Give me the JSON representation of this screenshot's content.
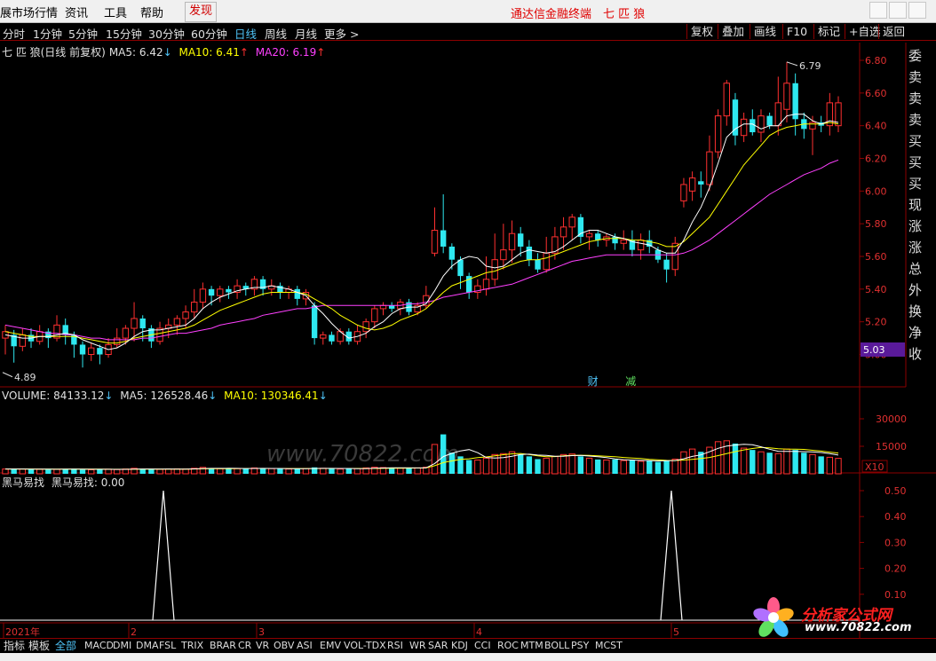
{
  "menubar": {
    "items": [
      "展市场行情",
      "资讯",
      "工具",
      "帮助"
    ],
    "discover": "发现",
    "title": "通达信金融终端　七 匹 狼"
  },
  "toolbar": {
    "periods": [
      "分时",
      "1分钟",
      "5分钟",
      "15分钟",
      "30分钟",
      "60分钟",
      "日线",
      "周线",
      "月线",
      "更多 >"
    ],
    "active_period": "日线",
    "right_buttons": [
      "复权",
      "叠加",
      "画线",
      "F10",
      "标记",
      "+自选",
      "返回"
    ]
  },
  "main_legend": {
    "stock": "七 匹 狼(日线 前复权)",
    "ma5": "MA5: 6.42",
    "ma10": "MA10: 6.41",
    "ma20": "MA20: 6.19"
  },
  "volume_legend": {
    "volume": "VOLUME: 84133.12",
    "ma5": "MA5: 126528.46",
    "ma10": "MA10: 130346.41"
  },
  "indicator_legend": {
    "name": "黑马易找",
    "value": "黑马易找: 0.00"
  },
  "side_panel": [
    "委",
    "卖",
    "卖",
    "卖",
    "买",
    "买",
    "买",
    "现",
    "涨",
    "涨",
    "总",
    "外",
    "换",
    "净",
    "收"
  ],
  "price_axis": [
    "6.80",
    "6.60",
    "6.40",
    "6.20",
    "6.00",
    "5.80",
    "5.60",
    "5.40",
    "5.20",
    "5.00"
  ],
  "current_price": "5.03",
  "volume_axis": [
    "30000",
    "15000"
  ],
  "volume_multiplier": "X10",
  "indicator_axis": [
    "0.50",
    "0.40",
    "0.30",
    "0.20",
    "0.10"
  ],
  "annotations": {
    "high": "6.79",
    "low": "4.89",
    "event_cai": "财",
    "event_jian": "减"
  },
  "date_axis": [
    "2021年",
    "2",
    "3",
    "4",
    "5"
  ],
  "bottom_tabs": [
    "指标",
    "模板",
    "全部",
    "MACD",
    "DMI",
    "DMA",
    "FSL",
    "TRIX",
    "BRAR",
    "CR",
    "VR",
    "OBV",
    "ASI",
    "EMV",
    "VOL-TDX",
    "RSI",
    "WR",
    "SAR",
    "KDJ",
    "CCI",
    "ROC",
    "MTM",
    "BOLL",
    "PSY",
    "MCST"
  ],
  "active_tab": "全部",
  "watermark": {
    "logo_text": "分析家公式网",
    "url": "www.70822.com",
    "mid_text": "www.70822.com"
  },
  "colors": {
    "up": "#ff3030",
    "down": "#2ee8f0",
    "ma5": "#ffffff",
    "ma10": "#ffff00",
    "ma20": "#ff40ff",
    "grid": "#8b0000",
    "axis_text": "#e03030"
  },
  "chart_data": [
    {
      "type": "candlestick",
      "title": "七 匹 狼(日线 前复权)",
      "ylim": [
        4.85,
        6.9
      ],
      "high_label": 6.79,
      "low_label": 4.89,
      "candles": [
        [
          5.1,
          5.14,
          5.0,
          5.18
        ],
        [
          5.12,
          5.05,
          4.95,
          5.15
        ],
        [
          5.05,
          5.12,
          5.02,
          5.16
        ],
        [
          5.12,
          5.08,
          5.04,
          5.16
        ],
        [
          5.08,
          5.14,
          5.06,
          5.18
        ],
        [
          5.14,
          5.1,
          5.04,
          5.16
        ],
        [
          5.1,
          5.18,
          5.08,
          5.24
        ],
        [
          5.18,
          5.12,
          5.06,
          5.22
        ],
        [
          5.12,
          5.06,
          4.98,
          5.14
        ],
        [
          5.06,
          5.0,
          4.92,
          5.08
        ],
        [
          5.0,
          5.04,
          4.96,
          5.07
        ],
        [
          5.04,
          5.0,
          4.94,
          5.06
        ],
        [
          5.0,
          5.06,
          4.98,
          5.1
        ],
        [
          5.06,
          5.1,
          5.04,
          5.16
        ],
        [
          5.1,
          5.16,
          5.06,
          5.18
        ],
        [
          5.16,
          5.22,
          5.08,
          5.32
        ],
        [
          5.22,
          5.16,
          5.08,
          5.24
        ],
        [
          5.16,
          5.08,
          5.04,
          5.18
        ],
        [
          5.08,
          5.16,
          5.06,
          5.2
        ],
        [
          5.16,
          5.18,
          5.1,
          5.22
        ],
        [
          5.18,
          5.22,
          5.12,
          5.24
        ],
        [
          5.22,
          5.26,
          5.16,
          5.3
        ],
        [
          5.26,
          5.32,
          5.22,
          5.4
        ],
        [
          5.32,
          5.4,
          5.28,
          5.44
        ],
        [
          5.4,
          5.36,
          5.3,
          5.42
        ],
        [
          5.36,
          5.4,
          5.32,
          5.42
        ],
        [
          5.4,
          5.38,
          5.34,
          5.42
        ],
        [
          5.38,
          5.42,
          5.34,
          5.46
        ],
        [
          5.42,
          5.4,
          5.36,
          5.44
        ],
        [
          5.4,
          5.46,
          5.36,
          5.48
        ],
        [
          5.46,
          5.4,
          5.36,
          5.48
        ],
        [
          5.4,
          5.42,
          5.36,
          5.46
        ],
        [
          5.42,
          5.38,
          5.34,
          5.44
        ],
        [
          5.38,
          5.4,
          5.34,
          5.42
        ],
        [
          5.4,
          5.34,
          5.3,
          5.42
        ],
        [
          5.34,
          5.38,
          5.3,
          5.4
        ],
        [
          5.3,
          5.1,
          5.06,
          5.32
        ],
        [
          5.1,
          5.12,
          5.06,
          5.14
        ],
        [
          5.12,
          5.08,
          5.06,
          5.14
        ],
        [
          5.08,
          5.14,
          5.06,
          5.16
        ],
        [
          5.14,
          5.08,
          5.06,
          5.16
        ],
        [
          5.08,
          5.14,
          5.06,
          5.18
        ],
        [
          5.14,
          5.2,
          5.1,
          5.22
        ],
        [
          5.2,
          5.28,
          5.16,
          5.3
        ],
        [
          5.28,
          5.3,
          5.24,
          5.32
        ],
        [
          5.3,
          5.28,
          5.26,
          5.32
        ],
        [
          5.28,
          5.32,
          5.24,
          5.34
        ],
        [
          5.32,
          5.26,
          5.24,
          5.34
        ],
        [
          5.26,
          5.3,
          5.24,
          5.32
        ],
        [
          5.3,
          5.36,
          5.28,
          5.42
        ],
        [
          5.62,
          5.76,
          5.6,
          5.9
        ],
        [
          5.76,
          5.66,
          5.62,
          5.98
        ],
        [
          5.66,
          5.58,
          5.52,
          5.68
        ],
        [
          5.58,
          5.48,
          5.4,
          5.6
        ],
        [
          5.48,
          5.38,
          5.34,
          5.5
        ],
        [
          5.38,
          5.42,
          5.34,
          5.46
        ],
        [
          5.4,
          5.46,
          5.36,
          5.6
        ],
        [
          5.46,
          5.58,
          5.42,
          5.74
        ],
        [
          5.58,
          5.64,
          5.52,
          5.8
        ],
        [
          5.64,
          5.74,
          5.56,
          5.82
        ],
        [
          5.74,
          5.66,
          5.6,
          5.78
        ],
        [
          5.66,
          5.58,
          5.54,
          5.7
        ],
        [
          5.58,
          5.52,
          5.5,
          5.62
        ],
        [
          5.52,
          5.62,
          5.5,
          5.72
        ],
        [
          5.62,
          5.72,
          5.58,
          5.78
        ],
        [
          5.72,
          5.78,
          5.64,
          5.84
        ],
        [
          5.78,
          5.84,
          5.7,
          5.86
        ],
        [
          5.84,
          5.72,
          5.68,
          5.86
        ],
        [
          5.72,
          5.74,
          5.64,
          5.76
        ],
        [
          5.74,
          5.7,
          5.66,
          5.76
        ],
        [
          5.7,
          5.72,
          5.66,
          5.74
        ],
        [
          5.72,
          5.68,
          5.64,
          5.74
        ],
        [
          5.68,
          5.7,
          5.64,
          5.76
        ],
        [
          5.7,
          5.64,
          5.6,
          5.76
        ],
        [
          5.64,
          5.7,
          5.58,
          5.74
        ],
        [
          5.7,
          5.66,
          5.62,
          5.76
        ],
        [
          5.64,
          5.58,
          5.56,
          5.66
        ],
        [
          5.58,
          5.52,
          5.44,
          5.62
        ],
        [
          5.52,
          5.68,
          5.48,
          5.72
        ],
        [
          5.94,
          6.04,
          5.9,
          6.08
        ],
        [
          6.0,
          6.08,
          5.94,
          6.12
        ],
        [
          6.06,
          6.04,
          5.96,
          6.12
        ],
        [
          6.04,
          6.24,
          6.0,
          6.34
        ],
        [
          6.24,
          6.46,
          6.2,
          6.5
        ],
        [
          6.46,
          6.66,
          6.4,
          6.68
        ],
        [
          6.56,
          6.34,
          6.28,
          6.6
        ],
        [
          6.34,
          6.44,
          6.3,
          6.48
        ],
        [
          6.44,
          6.36,
          6.34,
          6.5
        ],
        [
          6.36,
          6.46,
          6.3,
          6.5
        ],
        [
          6.46,
          6.4,
          6.38,
          6.48
        ],
        [
          6.4,
          6.54,
          6.34,
          6.7
        ],
        [
          6.5,
          6.66,
          6.42,
          6.79
        ],
        [
          6.66,
          6.44,
          6.34,
          6.72
        ],
        [
          6.44,
          6.38,
          6.32,
          6.48
        ],
        [
          6.38,
          6.42,
          6.22,
          6.46
        ],
        [
          6.42,
          6.4,
          6.36,
          6.46
        ],
        [
          6.4,
          6.54,
          6.34,
          6.6
        ],
        [
          6.4,
          6.54,
          6.36,
          6.58
        ]
      ],
      "ma5": [
        5.12,
        5.11,
        5.1,
        5.1,
        5.11,
        5.11,
        5.12,
        5.13,
        5.12,
        5.09,
        5.07,
        5.05,
        5.03,
        5.04,
        5.07,
        5.11,
        5.14,
        5.15,
        5.15,
        5.16,
        5.17,
        5.18,
        5.22,
        5.28,
        5.32,
        5.35,
        5.37,
        5.39,
        5.4,
        5.41,
        5.41,
        5.42,
        5.41,
        5.4,
        5.38,
        5.36,
        5.3,
        5.25,
        5.19,
        5.14,
        5.1,
        5.11,
        5.13,
        5.17,
        5.2,
        5.25,
        5.28,
        5.29,
        5.29,
        5.31,
        5.39,
        5.48,
        5.54,
        5.58,
        5.6,
        5.59,
        5.54,
        5.53,
        5.54,
        5.58,
        5.62,
        5.64,
        5.63,
        5.62,
        5.63,
        5.66,
        5.7,
        5.74,
        5.76,
        5.76,
        5.74,
        5.72,
        5.71,
        5.69,
        5.68,
        5.67,
        5.64,
        5.62,
        5.62,
        5.7,
        5.81,
        5.9,
        6.02,
        6.17,
        6.33,
        6.38,
        6.41,
        6.41,
        6.38,
        6.4,
        6.4,
        6.46,
        6.47,
        6.47,
        6.43,
        6.41,
        6.43,
        6.42
      ],
      "ma10": [
        5.14,
        5.13,
        5.12,
        5.11,
        5.11,
        5.11,
        5.11,
        5.11,
        5.11,
        5.1,
        5.09,
        5.08,
        5.07,
        5.07,
        5.08,
        5.1,
        5.11,
        5.12,
        5.13,
        5.14,
        5.15,
        5.16,
        5.18,
        5.21,
        5.24,
        5.27,
        5.29,
        5.31,
        5.33,
        5.35,
        5.37,
        5.38,
        5.38,
        5.38,
        5.38,
        5.37,
        5.34,
        5.31,
        5.28,
        5.24,
        5.21,
        5.18,
        5.16,
        5.15,
        5.16,
        5.18,
        5.21,
        5.23,
        5.25,
        5.28,
        5.33,
        5.38,
        5.42,
        5.44,
        5.46,
        5.48,
        5.5,
        5.51,
        5.53,
        5.55,
        5.57,
        5.58,
        5.58,
        5.59,
        5.61,
        5.63,
        5.65,
        5.67,
        5.69,
        5.7,
        5.71,
        5.71,
        5.71,
        5.7,
        5.7,
        5.69,
        5.68,
        5.66,
        5.66,
        5.69,
        5.74,
        5.79,
        5.84,
        5.92,
        6.0,
        6.08,
        6.16,
        6.22,
        6.28,
        6.34,
        6.37,
        6.39,
        6.4,
        6.41,
        6.41,
        6.41,
        6.42,
        6.41
      ],
      "ma20": [
        5.18,
        5.17,
        5.16,
        5.15,
        5.14,
        5.13,
        5.13,
        5.12,
        5.12,
        5.11,
        5.1,
        5.1,
        5.09,
        5.09,
        5.09,
        5.09,
        5.1,
        5.1,
        5.11,
        5.12,
        5.13,
        5.13,
        5.14,
        5.15,
        5.16,
        5.18,
        5.19,
        5.2,
        5.21,
        5.22,
        5.24,
        5.25,
        5.26,
        5.27,
        5.28,
        5.28,
        5.29,
        5.3,
        5.3,
        5.3,
        5.3,
        5.3,
        5.3,
        5.3,
        5.3,
        5.3,
        5.3,
        5.31,
        5.31,
        5.32,
        5.33,
        5.35,
        5.36,
        5.37,
        5.38,
        5.39,
        5.4,
        5.41,
        5.42,
        5.43,
        5.45,
        5.47,
        5.49,
        5.51,
        5.53,
        5.55,
        5.57,
        5.58,
        5.59,
        5.6,
        5.61,
        5.61,
        5.61,
        5.61,
        5.61,
        5.61,
        5.61,
        5.61,
        5.61,
        5.62,
        5.64,
        5.67,
        5.7,
        5.74,
        5.78,
        5.82,
        5.86,
        5.9,
        5.94,
        5.98,
        6.01,
        6.04,
        6.07,
        6.1,
        6.12,
        6.14,
        6.17,
        6.19
      ]
    },
    {
      "type": "bar",
      "title": "VOLUME",
      "ylim": [
        0,
        42000
      ],
      "values": [
        2600,
        2800,
        2600,
        2400,
        2500,
        2300,
        2400,
        2600,
        2800,
        2300,
        2200,
        2400,
        2500,
        2300,
        2600,
        3000,
        2600,
        2400,
        2500,
        2600,
        2700,
        2600,
        3000,
        3500,
        3000,
        2800,
        2700,
        2800,
        3000,
        3200,
        3000,
        2800,
        2700,
        2600,
        2800,
        2900,
        3500,
        3000,
        2800,
        2600,
        2700,
        2900,
        3200,
        3600,
        3400,
        3200,
        3100,
        3000,
        3200,
        3600,
        16000,
        21500,
        11500,
        9500,
        7500,
        7500,
        8500,
        10500,
        11000,
        12000,
        10500,
        9500,
        8000,
        8500,
        9500,
        10500,
        10800,
        9500,
        8500,
        7800,
        7500,
        7800,
        7200,
        7400,
        6800,
        7200,
        6500,
        7500,
        8000,
        12000,
        13500,
        12000,
        14500,
        17500,
        18000,
        16500,
        14000,
        13000,
        12000,
        11500,
        11000,
        13500,
        13000,
        11500,
        10500,
        9500,
        9000,
        8400
      ],
      "ma5": [
        2600,
        2600,
        2600,
        2580,
        2560,
        2520,
        2480,
        2500,
        2520,
        2500,
        2480,
        2480,
        2460,
        2420,
        2440,
        2560,
        2600,
        2600,
        2580,
        2620,
        2560,
        2560,
        2680,
        2860,
        2960,
        2960,
        3000,
        2960,
        2860,
        2900,
        2940,
        2900,
        2880,
        2820,
        2780,
        2760,
        2900,
        2960,
        2960,
        2900,
        2920,
        2800,
        2840,
        3040,
        3160,
        3240,
        3280,
        3300,
        3200,
        3220,
        5600,
        9400,
        11200,
        12500,
        13200,
        11500,
        8900,
        8600,
        8800,
        9600,
        10500,
        10700,
        10200,
        10000,
        9600,
        9600,
        9900,
        10000,
        9700,
        9300,
        8800,
        8100,
        7700,
        7500,
        7300,
        7200,
        7000,
        7100,
        7200,
        8200,
        9500,
        10300,
        12000,
        13900,
        15100,
        15700,
        16100,
        15800,
        14700,
        13400,
        12300,
        12200,
        12200,
        12100,
        11900,
        11600,
        11000,
        10200
      ],
      "ma10": [
        2600,
        2600,
        2600,
        2600,
        2580,
        2560,
        2540,
        2540,
        2540,
        2520,
        2510,
        2500,
        2490,
        2470,
        2460,
        2480,
        2500,
        2510,
        2510,
        2530,
        2560,
        2580,
        2620,
        2690,
        2760,
        2800,
        2820,
        2850,
        2880,
        2900,
        2910,
        2910,
        2890,
        2870,
        2850,
        2840,
        2870,
        2900,
        2920,
        2910,
        2900,
        2880,
        2870,
        2890,
        2930,
        2990,
        3050,
        3110,
        3150,
        3180,
        4400,
        6100,
        7000,
        7900,
        8200,
        8800,
        9200,
        9800,
        10400,
        10900,
        11100,
        10500,
        9800,
        9300,
        9400,
        9800,
        10000,
        10100,
        10000,
        9800,
        9600,
        9300,
        8900,
        8600,
        8300,
        7900,
        7600,
        7300,
        7200,
        7500,
        7900,
        8300,
        8900,
        9900,
        11000,
        12100,
        13000,
        13800,
        14400,
        14200,
        13700,
        13400,
        13400,
        13300,
        12800,
        12400,
        11800,
        11300
      ]
    },
    {
      "type": "line",
      "title": "黑马易找",
      "ylim": [
        0,
        0.55
      ],
      "spikes": [
        {
          "candle_index": 23,
          "value": 0.5
        },
        {
          "candle_index": 99,
          "value": 0.5
        }
      ],
      "baseline": 0
    }
  ]
}
